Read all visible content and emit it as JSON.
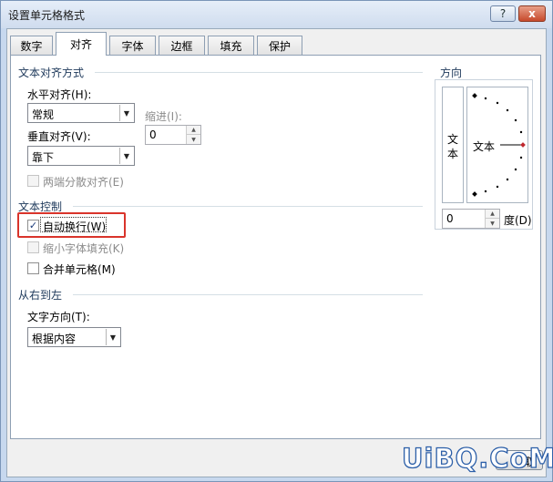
{
  "window": {
    "title": "设置单元格格式",
    "help_label": "?",
    "close_label": "x"
  },
  "tabs": [
    {
      "label": "数字",
      "active": false
    },
    {
      "label": "对齐",
      "active": true
    },
    {
      "label": "字体",
      "active": false
    },
    {
      "label": "边框",
      "active": false
    },
    {
      "label": "填充",
      "active": false
    },
    {
      "label": "保护",
      "active": false
    }
  ],
  "text_alignment": {
    "group_title": "文本对齐方式",
    "horizontal_label": "水平对齐(H):",
    "horizontal_value": "常规",
    "indent_label": "缩进(I):",
    "indent_value": "0",
    "vertical_label": "垂直对齐(V):",
    "vertical_value": "靠下",
    "distributed_label": "两端分散对齐(E)"
  },
  "text_control": {
    "group_title": "文本控制",
    "wrap_text_label": "自动换行(W)",
    "wrap_text_checked": true,
    "shrink_label": "缩小字体填充(K)",
    "merge_label": "合并单元格(M)"
  },
  "rtl": {
    "group_title": "从右到左",
    "direction_label": "文字方向(T):",
    "direction_value": "根据内容"
  },
  "orientation": {
    "group_title": "方向",
    "vertical_text_1": "文",
    "vertical_text_2": "本",
    "dial_text": "文本",
    "degrees_value": "0",
    "degrees_label": "度(D)"
  },
  "watermark": {
    "text": "UiBQ.CoM",
    "button_fragment": "取"
  },
  "colors": {
    "highlight_red": "#d9342b",
    "dial_marker": "#c0282f"
  }
}
